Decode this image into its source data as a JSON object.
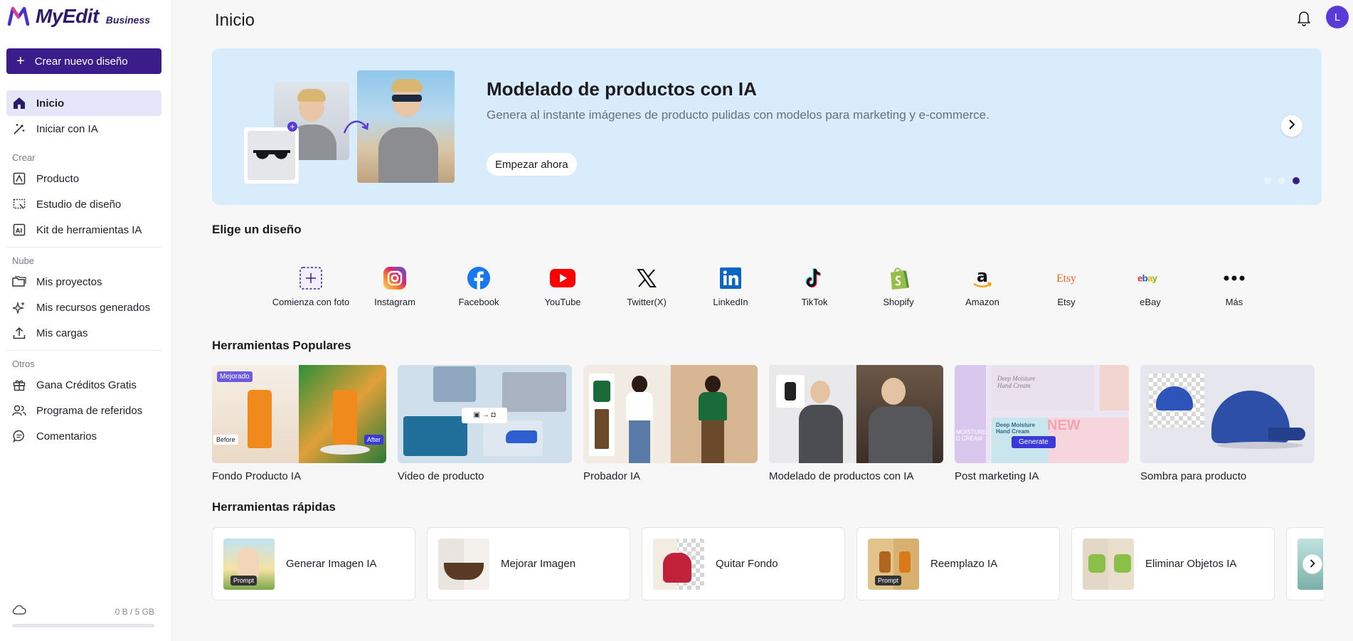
{
  "brand": {
    "name": "MyEdit",
    "tier": "Business"
  },
  "sidebar": {
    "create_button": "Crear nuevo diseño",
    "main": [
      {
        "label": "Inicio",
        "icon": "home-icon",
        "active": true
      },
      {
        "label": "Iniciar con IA",
        "icon": "magic-wand-icon"
      }
    ],
    "create_section": "Crear",
    "create_items": [
      {
        "label": "Producto",
        "icon": "product-icon"
      },
      {
        "label": "Estudio de diseño",
        "icon": "design-studio-icon"
      },
      {
        "label": "Kit de herramientas IA",
        "icon": "ai-toolkit-icon"
      }
    ],
    "cloud_section": "Nube",
    "cloud_items": [
      {
        "label": "Mis proyectos",
        "icon": "folders-icon"
      },
      {
        "label": "Mis recursos generados",
        "icon": "sparkle-icon"
      },
      {
        "label": "Mis cargas",
        "icon": "upload-icon"
      }
    ],
    "other_section": "Otros",
    "other_items": [
      {
        "label": "Gana Créditos Gratis",
        "icon": "gift-icon"
      },
      {
        "label": "Programa de referidos",
        "icon": "users-icon"
      },
      {
        "label": "Comentarios",
        "icon": "comment-icon"
      }
    ],
    "storage": {
      "text": "0 B / 5 GB",
      "used_fraction": 0
    }
  },
  "header": {
    "title": "Inicio",
    "avatar_letter": "L"
  },
  "banner": {
    "title": "Modelado de productos con IA",
    "subtitle": "Genera al instante imágenes de producto pulidas con modelos para marketing y e-commerce.",
    "button": "Empezar ahora",
    "active_slide": 3,
    "slides": 3
  },
  "design_section": {
    "title": "Elige un diseño",
    "items": [
      {
        "label": "Comienza con foto",
        "icon": "add-photo-icon"
      },
      {
        "label": "Instagram",
        "icon": "instagram-icon"
      },
      {
        "label": "Facebook",
        "icon": "facebook-icon"
      },
      {
        "label": "YouTube",
        "icon": "youtube-icon"
      },
      {
        "label": "Twitter(X)",
        "icon": "x-icon"
      },
      {
        "label": "LinkedIn",
        "icon": "linkedin-icon"
      },
      {
        "label": "TikTok",
        "icon": "tiktok-icon"
      },
      {
        "label": "Shopify",
        "icon": "shopify-icon"
      },
      {
        "label": "Amazon",
        "icon": "amazon-icon"
      },
      {
        "label": "Etsy",
        "icon": "etsy-icon"
      },
      {
        "label": "eBay",
        "icon": "ebay-icon"
      },
      {
        "label": "Más",
        "icon": "more-icon"
      }
    ]
  },
  "popular": {
    "title": "Herramientas Populares",
    "items": [
      {
        "label": "Fondo Producto IA",
        "badge": "Mejorado",
        "before": "Before",
        "after": "After"
      },
      {
        "label": "Video de producto"
      },
      {
        "label": "Probador IA"
      },
      {
        "label": "Modelado de productos con IA"
      },
      {
        "label": "Post marketing IA",
        "thumb_text1": "Deep Moisture Hand Cream",
        "thumb_text2": "MOISTURE D CREAM",
        "thumb_text3": "Deep Moisture Hand Cream",
        "thumb_button": "Generate",
        "thumb_text4": "NEW"
      },
      {
        "label": "Sombra para producto"
      }
    ]
  },
  "quick": {
    "title": "Herramientas rápidas",
    "prompt_badge": "Prompt",
    "items": [
      {
        "label": "Generar Imagen IA"
      },
      {
        "label": "Mejorar Imagen"
      },
      {
        "label": "Quitar Fondo"
      },
      {
        "label": "Reemplazo IA"
      },
      {
        "label": "Eliminar Objetos IA"
      },
      {
        "label": ""
      }
    ]
  }
}
